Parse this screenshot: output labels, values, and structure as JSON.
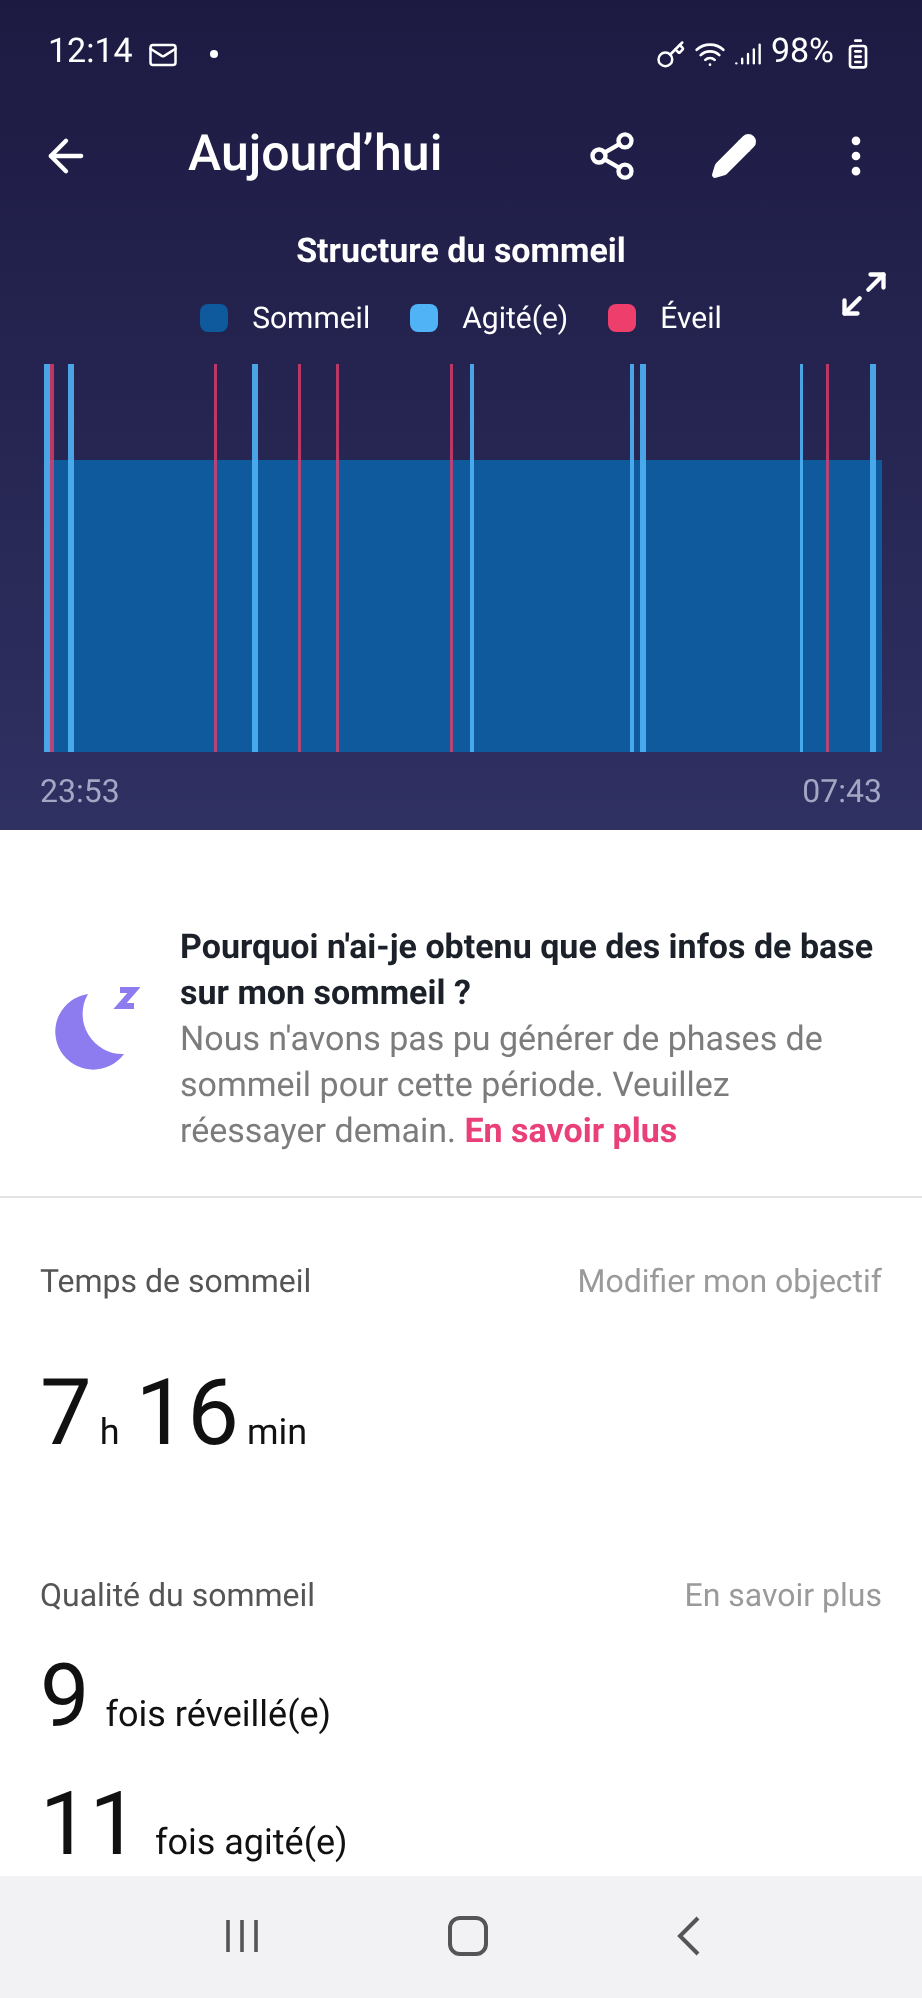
{
  "status_bar": {
    "time": "12:14",
    "battery": "98%"
  },
  "header": {
    "title": "Aujourd’hui"
  },
  "chart": {
    "title": "Structure du sommeil",
    "legend": [
      {
        "label": "Sommeil",
        "color": "#0f5a9c"
      },
      {
        "label": "Agité(e)",
        "color": "#4fb3f5"
      },
      {
        "label": "Éveil",
        "color": "#ee3e6c"
      }
    ],
    "start": "23:53",
    "end": "07:43"
  },
  "notice": {
    "title": "Pourquoi n'ai-je obtenu que des infos de base sur mon sommeil ?",
    "body": "Nous n'avons pas pu générer de phases de sommeil pour cette période. Veuillez réessayer demain.",
    "link": "En savoir plus"
  },
  "sleep_time": {
    "label": "Temps de sommeil",
    "action": "Modifier mon objectif",
    "hours": "7",
    "hours_unit": "h",
    "minutes": "16",
    "minutes_unit": "min"
  },
  "quality": {
    "label": "Qualité du sommeil",
    "action": "En savoir plus",
    "stats": [
      {
        "value": "9",
        "text": "fois réveillé(e)"
      },
      {
        "value": "11",
        "text": "fois agité(e)"
      }
    ]
  }
}
